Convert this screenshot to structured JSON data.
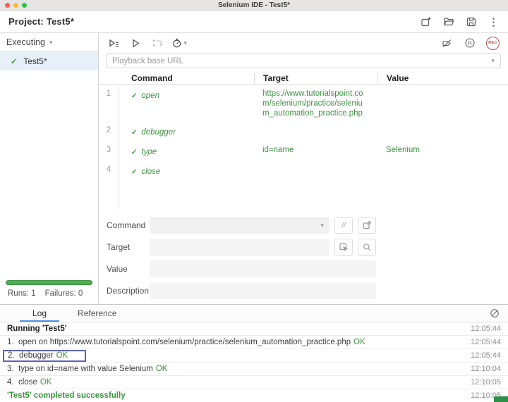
{
  "window": {
    "title": "Selenium IDE - Test5*"
  },
  "header": {
    "project_label": "Project:",
    "project_name": "Test5*"
  },
  "toolbar": {
    "rec_label": "REC"
  },
  "sidebar": {
    "dropdown_label": "Executing",
    "tests": [
      {
        "name": "Test5*",
        "check": "✓"
      }
    ],
    "runs_label": "Runs: 1",
    "failures_label": "Failures: 0"
  },
  "playback": {
    "placeholder": "Playback base URL"
  },
  "commands_table": {
    "headers": {
      "command": "Command",
      "target": "Target",
      "value": "Value"
    },
    "check_glyph": "✓",
    "rows": [
      {
        "num": "1",
        "command": "open",
        "target": "https://www.tutorialspoint.com/selenium/practice/selenium_automation_practice.php",
        "value": ""
      },
      {
        "num": "2",
        "command": "debugger",
        "target": "",
        "value": ""
      },
      {
        "num": "3",
        "command": "type",
        "target": "id=name",
        "value": "Selenium"
      },
      {
        "num": "4",
        "command": "close",
        "target": "",
        "value": ""
      }
    ]
  },
  "editor": {
    "command_label": "Command",
    "target_label": "Target",
    "value_label": "Value",
    "description_label": "Description",
    "slash_button": "//"
  },
  "log_panel": {
    "tabs": {
      "log": "Log",
      "reference": "Reference"
    },
    "entries": [
      {
        "num": "",
        "text": "Running 'Test5'",
        "ok": "",
        "time": "12:05:44",
        "bold": true,
        "green": false,
        "boxed": false
      },
      {
        "num": "1.",
        "text": "open on https://www.tutorialspoint.com/selenium/practice/selenium_automation_practice.php",
        "ok": "OK",
        "time": "12:05:44",
        "bold": false,
        "green": false,
        "boxed": false
      },
      {
        "num": "2.",
        "text": "debugger",
        "ok": "OK",
        "time": "12:05:44",
        "bold": false,
        "green": false,
        "boxed": true
      },
      {
        "num": "3.",
        "text": "type on id=name with value Selenium",
        "ok": "OK",
        "time": "12:10:04",
        "bold": false,
        "green": false,
        "boxed": false
      },
      {
        "num": "4.",
        "text": "close",
        "ok": "OK",
        "time": "12:10:05",
        "bold": false,
        "green": false,
        "boxed": false
      },
      {
        "num": "",
        "text": "'Test5' completed successfully",
        "ok": "",
        "time": "12:10:05",
        "bold": true,
        "green": true,
        "boxed": false
      }
    ]
  },
  "colors": {
    "success_green": "#3f9142",
    "progress_green": "#4caf50",
    "rec_red": "#b3524d",
    "active_tab_blue": "#4a90e2",
    "selected_item_bg": "#e7f0f9",
    "debug_box_border": "#5b63b7"
  }
}
